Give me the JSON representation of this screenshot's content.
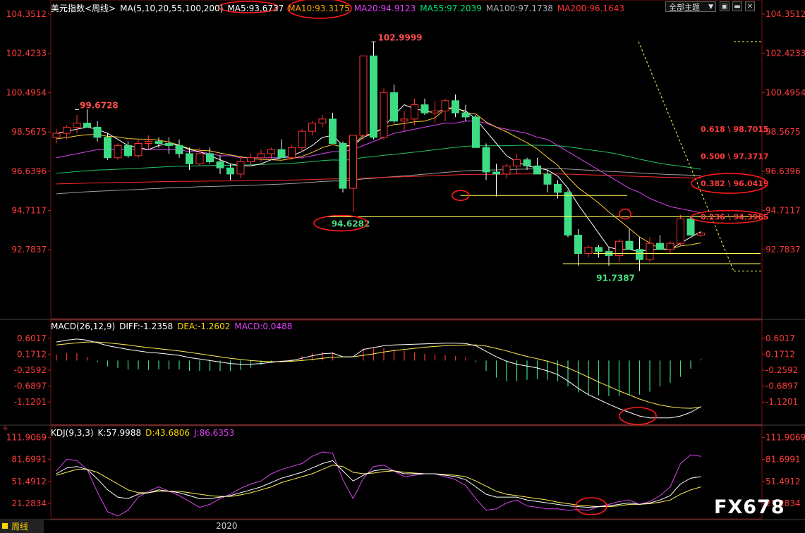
{
  "main_header": {
    "title": "美元指数<周线>",
    "ma_params": "MA(5,10,20,55,100,200)",
    "ma5": "MA5:93.6737",
    "ma10": "MA10:93.3175",
    "ma20": "MA20:94.9123",
    "ma55": "MA55:97.2039",
    "ma100": "MA100:97.1738",
    "ma200": "MA200:96.1643"
  },
  "toolbar": {
    "topic_select": "全部主题",
    "topic_arrow": "▼",
    "restore": "▣",
    "minimize": "▬",
    "close": "✕"
  },
  "macd_header": {
    "title": "MACD(26,12,9)",
    "diff": "DIFF:-1.2358",
    "dea": "DEA:-1.2602",
    "macd": "MACD:0.0488"
  },
  "kdj_header": {
    "title": "KDJ(9,3,3)",
    "k": "K:57.9988",
    "d": "D:43.6806",
    "j": "J:86.6353"
  },
  "footer": {
    "period_label": "周线",
    "year": "2020",
    "watermark": "FX678"
  },
  "chart_data": [
    {
      "type": "candlestick",
      "title": "美元指数<周线>",
      "y_ticks": [
        "104.3512",
        "102.4233",
        "100.4954",
        "98.5675",
        "96.6396",
        "94.7117",
        "92.7837"
      ],
      "ylim": [
        91.2,
        104.3512
      ],
      "annotations": {
        "high_label": "102.9999",
        "left_high_label": "99.6728",
        "low_label_circled": "94.6282",
        "bottom_low_label": "91.7387"
      },
      "fibonacci_labels": [
        "0.618 \\ 98.7015",
        "0.500 \\ 97.3717",
        "0.382 \\ 96.0419",
        "0.236 \\ 94.3965"
      ],
      "fibonacci_levels": [
        98.7015,
        97.3717,
        96.0419,
        94.3965
      ],
      "horizontal_lines": [
        95.45,
        94.4,
        92.6,
        92.1
      ],
      "candles": [
        [
          98.3,
          98.7,
          98.0,
          98.5
        ],
        [
          98.5,
          98.9,
          98.2,
          98.8
        ],
        [
          98.8,
          99.4,
          98.5,
          99.0
        ],
        [
          99.0,
          99.67,
          98.8,
          98.8
        ],
        [
          98.8,
          99.1,
          98.1,
          98.3
        ],
        [
          98.3,
          98.5,
          97.2,
          97.3
        ],
        [
          97.3,
          98.0,
          97.2,
          97.9
        ],
        [
          97.9,
          98.1,
          97.3,
          97.4
        ],
        [
          97.4,
          98.2,
          97.3,
          98.0
        ],
        [
          98.0,
          98.4,
          97.7,
          98.1
        ],
        [
          98.1,
          98.3,
          97.8,
          98.0
        ],
        [
          98.0,
          98.3,
          97.5,
          97.9
        ],
        [
          97.9,
          98.2,
          97.3,
          97.5
        ],
        [
          97.5,
          97.8,
          96.7,
          97.0
        ],
        [
          97.0,
          97.8,
          96.9,
          97.5
        ],
        [
          97.5,
          97.8,
          97.0,
          97.1
        ],
        [
          97.1,
          97.4,
          96.5,
          96.8
        ],
        [
          96.8,
          97.0,
          96.2,
          96.5
        ],
        [
          96.5,
          97.4,
          96.3,
          97.1
        ],
        [
          97.1,
          97.5,
          96.9,
          97.3
        ],
        [
          97.3,
          97.7,
          97.1,
          97.5
        ],
        [
          97.5,
          97.8,
          97.2,
          97.7
        ],
        [
          97.7,
          98.2,
          97.5,
          97.3
        ],
        [
          97.3,
          97.9,
          97.2,
          97.8
        ],
        [
          97.8,
          98.7,
          97.6,
          98.6
        ],
        [
          98.6,
          99.1,
          98.4,
          99.0
        ],
        [
          99.0,
          99.4,
          98.8,
          99.2
        ],
        [
          99.2,
          99.5,
          98.0,
          98.0
        ],
        [
          98.0,
          98.1,
          95.6,
          95.8
        ],
        [
          95.8,
          98.0,
          94.63,
          98.4
        ],
        [
          98.4,
          102.2,
          98.2,
          102.3
        ],
        [
          102.3,
          102.99,
          98.2,
          98.3
        ],
        [
          98.3,
          100.7,
          98.2,
          100.5
        ],
        [
          100.5,
          100.9,
          99.0,
          99.1
        ],
        [
          99.1,
          99.6,
          98.6,
          99.2
        ],
        [
          99.2,
          100.2,
          98.9,
          99.9
        ],
        [
          99.9,
          100.2,
          99.4,
          99.5
        ],
        [
          99.5,
          100.1,
          99.0,
          99.6
        ],
        [
          99.6,
          100.2,
          99.1,
          100.1
        ],
        [
          100.1,
          100.4,
          99.3,
          99.5
        ],
        [
          99.5,
          99.9,
          99.1,
          99.3
        ],
        [
          99.3,
          99.4,
          97.8,
          97.8
        ],
        [
          97.8,
          98.0,
          96.2,
          96.6
        ],
        [
          96.6,
          97.0,
          95.4,
          96.5
        ],
        [
          96.5,
          97.0,
          96.3,
          96.9
        ],
        [
          96.9,
          97.5,
          96.5,
          97.2
        ],
        [
          97.2,
          97.3,
          96.7,
          96.9
        ],
        [
          96.9,
          97.3,
          96.5,
          96.5
        ],
        [
          96.5,
          96.7,
          95.6,
          96.0
        ],
        [
          96.0,
          96.2,
          95.3,
          95.6
        ],
        [
          95.6,
          95.7,
          93.4,
          93.5
        ],
        [
          93.5,
          93.8,
          92.0,
          92.6
        ],
        [
          92.6,
          93.0,
          92.4,
          92.9
        ],
        [
          92.9,
          93.0,
          92.4,
          92.7
        ],
        [
          92.7,
          92.9,
          92.0,
          92.5
        ],
        [
          92.5,
          93.3,
          92.2,
          93.2
        ],
        [
          93.2,
          93.8,
          92.8,
          92.8
        ],
        [
          92.8,
          93.4,
          91.74,
          92.3
        ],
        [
          92.3,
          93.4,
          92.2,
          93.1
        ],
        [
          93.1,
          93.5,
          92.8,
          92.8
        ],
        [
          92.8,
          93.2,
          92.6,
          93.1
        ],
        [
          93.1,
          94.5,
          93.0,
          94.3
        ],
        [
          94.3,
          94.4,
          93.5,
          93.5
        ],
        [
          93.5,
          93.7,
          93.4,
          93.6
        ]
      ],
      "ma5_values": [
        98.5,
        98.6,
        98.7,
        98.8,
        98.7,
        98.5,
        98.2,
        97.9,
        97.8,
        97.7,
        97.9,
        98.0,
        97.9,
        97.7,
        97.6,
        97.4,
        97.2,
        97.0,
        96.9,
        96.9,
        97.0,
        97.2,
        97.3,
        97.4,
        97.6,
        97.9,
        98.3,
        98.4,
        97.9,
        97.9,
        98.3,
        98.5,
        98.8,
        99.4,
        99.9,
        99.7,
        99.6,
        99.5,
        99.7,
        99.7,
        99.6,
        99.2,
        98.6,
        98.0,
        97.4,
        97.1,
        96.9,
        96.8,
        96.7,
        96.4,
        95.8,
        95.0,
        94.3,
        93.6,
        92.9,
        92.8,
        92.8,
        92.7,
        92.8,
        92.8,
        92.8,
        93.1,
        93.4,
        93.67
      ],
      "ma20_values": [
        97.3,
        97.4,
        97.5,
        97.6,
        97.7,
        97.7,
        97.7,
        97.7,
        97.7,
        97.7,
        97.7,
        97.7,
        97.7,
        97.6,
        97.6,
        97.5,
        97.4,
        97.4,
        97.3,
        97.3,
        97.3,
        97.3,
        97.3,
        97.3,
        97.3,
        97.4,
        97.5,
        97.6,
        97.6,
        97.7,
        97.9,
        98.1,
        98.3,
        98.5,
        98.6,
        98.7,
        98.8,
        98.9,
        99.0,
        99.0,
        99.1,
        99.1,
        99.0,
        98.8,
        98.7,
        98.6,
        98.5,
        98.3,
        98.2,
        97.9,
        97.6,
        97.3,
        97.0,
        96.7,
        96.4,
        96.1,
        95.8,
        95.6,
        95.3,
        95.1,
        94.9,
        94.8,
        94.7,
        94.6
      ]
    },
    {
      "type": "macd",
      "title": "MACD(26,12,9)",
      "y_ticks": [
        "0.6017",
        "0.1712",
        "-0.2592",
        "-0.6897",
        "-1.1201"
      ],
      "ylim": [
        -1.65,
        0.75
      ],
      "diff": [
        0.5,
        0.55,
        0.58,
        0.55,
        0.48,
        0.4,
        0.35,
        0.3,
        0.26,
        0.22,
        0.2,
        0.17,
        0.14,
        0.08,
        0.04,
        0.0,
        -0.04,
        -0.08,
        -0.1,
        -0.1,
        -0.08,
        -0.05,
        -0.02,
        0.0,
        0.06,
        0.13,
        0.18,
        0.2,
        0.1,
        0.1,
        0.3,
        0.35,
        0.4,
        0.42,
        0.43,
        0.44,
        0.45,
        0.46,
        0.47,
        0.47,
        0.46,
        0.4,
        0.25,
        0.1,
        -0.02,
        -0.1,
        -0.15,
        -0.2,
        -0.28,
        -0.38,
        -0.55,
        -0.75,
        -0.92,
        -1.05,
        -1.18,
        -1.3,
        -1.4,
        -1.5,
        -1.55,
        -1.55,
        -1.55,
        -1.5,
        -1.4,
        -1.24
      ],
      "dea": [
        0.42,
        0.45,
        0.48,
        0.5,
        0.5,
        0.48,
        0.45,
        0.42,
        0.38,
        0.35,
        0.32,
        0.29,
        0.26,
        0.22,
        0.18,
        0.14,
        0.1,
        0.06,
        0.03,
        0.0,
        -0.02,
        -0.03,
        -0.03,
        -0.02,
        0.0,
        0.03,
        0.06,
        0.09,
        0.1,
        0.1,
        0.14,
        0.18,
        0.23,
        0.27,
        0.3,
        0.33,
        0.36,
        0.38,
        0.4,
        0.41,
        0.42,
        0.42,
        0.39,
        0.33,
        0.26,
        0.18,
        0.11,
        0.05,
        -0.02,
        -0.1,
        -0.2,
        -0.32,
        -0.45,
        -0.58,
        -0.7,
        -0.82,
        -0.93,
        -1.04,
        -1.13,
        -1.2,
        -1.25,
        -1.28,
        -1.29,
        -1.26
      ],
      "hist": [
        0.16,
        0.2,
        0.2,
        0.1,
        -0.04,
        -0.16,
        -0.2,
        -0.24,
        -0.24,
        -0.26,
        -0.24,
        -0.24,
        -0.24,
        -0.28,
        -0.28,
        -0.28,
        -0.28,
        -0.28,
        -0.26,
        -0.2,
        -0.12,
        -0.04,
        0.02,
        0.04,
        0.12,
        0.2,
        0.24,
        0.22,
        0.0,
        0.0,
        0.32,
        0.34,
        0.34,
        0.3,
        0.26,
        0.22,
        0.18,
        0.16,
        0.14,
        0.12,
        0.08,
        -0.04,
        -0.28,
        -0.46,
        -0.56,
        -0.56,
        -0.52,
        -0.5,
        -0.52,
        -0.56,
        -0.7,
        -0.86,
        -0.94,
        -0.94,
        -0.96,
        -0.96,
        -0.94,
        -0.92,
        -0.84,
        -0.7,
        -0.6,
        -0.44,
        -0.22,
        0.05
      ]
    },
    {
      "type": "kdj",
      "title": "KDJ(9,3,3)",
      "y_ticks": [
        "111.9069",
        "81.6991",
        "51.4912",
        "21.2834"
      ],
      "ylim": [
        4,
        120
      ],
      "k": [
        62,
        70,
        72,
        68,
        55,
        40,
        30,
        28,
        34,
        36,
        40,
        38,
        36,
        32,
        28,
        28,
        30,
        32,
        36,
        40,
        44,
        50,
        56,
        60,
        64,
        70,
        76,
        80,
        66,
        52,
        60,
        66,
        68,
        66,
        62,
        62,
        62,
        62,
        60,
        58,
        54,
        44,
        34,
        30,
        30,
        30,
        26,
        24,
        22,
        20,
        18,
        17,
        16,
        17,
        18,
        20,
        22,
        20,
        22,
        26,
        32,
        48,
        56,
        58
      ],
      "d": [
        60,
        64,
        68,
        68,
        64,
        56,
        48,
        40,
        36,
        36,
        38,
        38,
        38,
        36,
        34,
        32,
        31,
        31,
        33,
        36,
        40,
        44,
        50,
        54,
        58,
        62,
        68,
        74,
        72,
        64,
        62,
        63,
        65,
        66,
        64,
        63,
        62,
        62,
        61,
        60,
        58,
        52,
        45,
        38,
        34,
        32,
        30,
        28,
        26,
        23,
        21,
        19,
        18,
        17,
        17,
        18,
        20,
        20,
        21,
        23,
        26,
        34,
        40,
        44
      ],
      "j": [
        66,
        82,
        80,
        68,
        37,
        10,
        4,
        12,
        30,
        38,
        44,
        38,
        32,
        24,
        16,
        20,
        28,
        34,
        42,
        48,
        52,
        62,
        68,
        72,
        76,
        86,
        92,
        90,
        54,
        28,
        56,
        72,
        74,
        66,
        58,
        60,
        62,
        62,
        58,
        54,
        46,
        28,
        12,
        14,
        22,
        26,
        18,
        16,
        14,
        14,
        12,
        13,
        12,
        17,
        20,
        24,
        26,
        20,
        24,
        32,
        44,
        76,
        88,
        86
      ]
    }
  ]
}
